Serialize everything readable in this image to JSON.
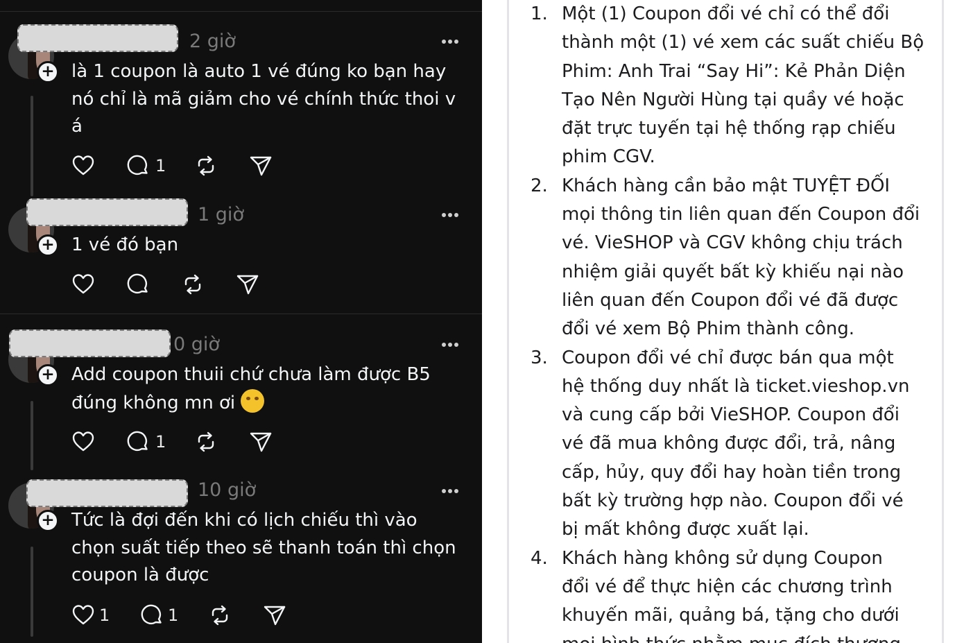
{
  "comments": [
    {
      "author": "",
      "time": "2 giờ",
      "lines": [
        "là 1 coupon là auto 1 vé đúng ko bạn hay",
        "nó chỉ là mã giảm cho vé chính thức thoi v",
        "á"
      ],
      "like_count": "",
      "reply_count": "1"
    },
    {
      "author": "",
      "time": "1 giờ",
      "lines": [
        "1 vé đó bạn"
      ],
      "like_count": "",
      "reply_count": ""
    },
    {
      "author": "",
      "time": "0 giờ",
      "lines": [
        "Add coupon thuii chứ chưa làm được B5",
        "đúng không mn ơi"
      ],
      "emoji": "🫠",
      "like_count": "",
      "reply_count": "1"
    },
    {
      "author": "",
      "time": "10 giờ",
      "lines": [
        "Tức là đợi đến khi có lịch chiếu thì vào",
        "chọn suất tiếp theo sẽ thanh toán thì chọn",
        "coupon là được"
      ],
      "like_count": "1",
      "reply_count": "1"
    }
  ],
  "icons": {
    "follow": "plus-icon",
    "more": "more-icon",
    "like": "heart-icon",
    "reply": "comment-icon",
    "repost": "repost-icon",
    "share": "send-icon"
  },
  "terms": [
    {
      "number": "1.",
      "lines": [
        "Một (1) Coupon đổi vé chỉ có thể đổi",
        "thành một (1) vé xem các suất chiếu Bộ",
        "Phim: Anh Trai “Say Hi”: Kẻ Phản Diện",
        "Tạo Nên Người Hùng tại quầy vé hoặc",
        "đặt trực tuyến tại hệ thống rạp chiếu",
        "phim CGV."
      ]
    },
    {
      "number": "2.",
      "lines": [
        "Khách hàng cần bảo mật TUYỆT ĐỐI",
        "mọi thông tin liên quan đến Coupon đổi",
        "vé. VieSHOP và CGV không chịu trách",
        "nhiệm giải quyết bất kỳ khiếu nại nào",
        "liên quan đến Coupon đổi vé đã được",
        "đổi vé xem Bộ Phim thành công."
      ]
    },
    {
      "number": "3.",
      "lines": [
        "Coupon đổi vé chỉ được bán qua một",
        "hệ thống duy nhất là ticket.vieshop.vn",
        "và cung cấp bởi VieSHOP. Coupon đổi",
        "vé đã mua không được đổi, trả, nâng",
        "cấp, hủy, quy đổi hay hoàn tiền trong",
        "bất kỳ trường hợp nào. Coupon đổi vé",
        "bị mất không được xuất lại."
      ]
    },
    {
      "number": "4.",
      "lines": [
        "Khách hàng không sử dụng Coupon",
        "đổi vé để thực hiện các chương trình",
        "khuyến mãi, quảng bá, tặng cho dưới",
        "mọi hình thức nhằm mục đích thương"
      ]
    }
  ]
}
